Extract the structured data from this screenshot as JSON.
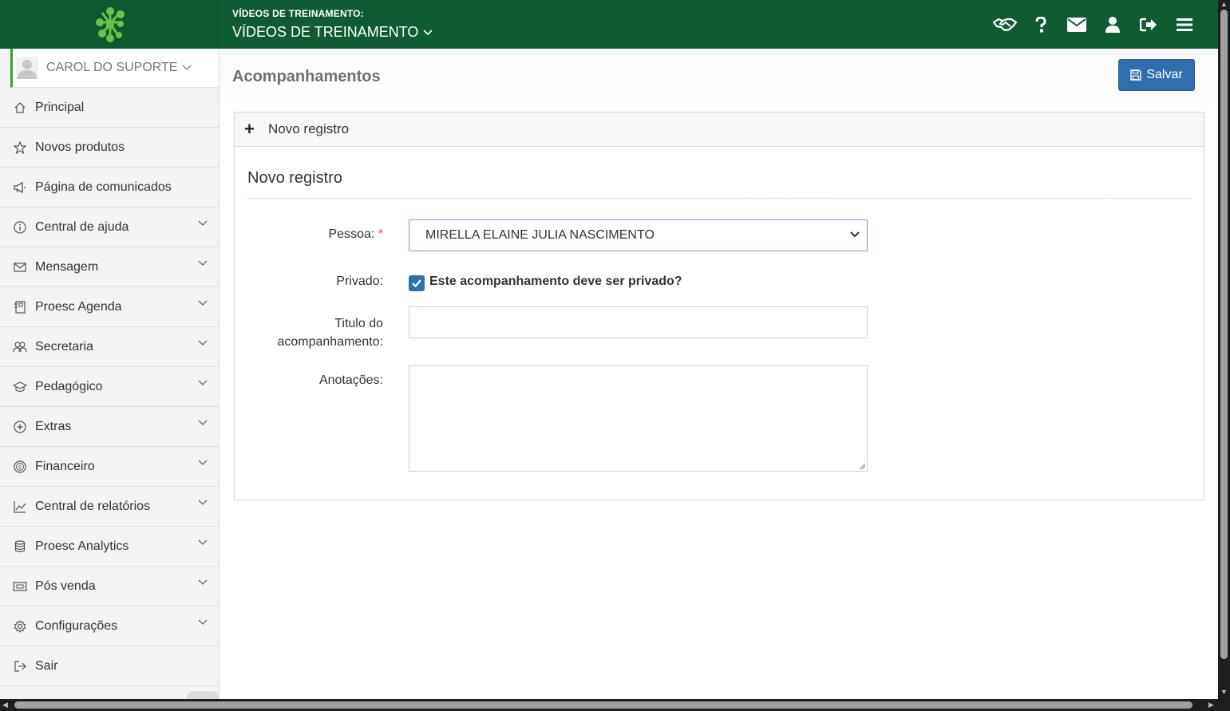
{
  "header": {
    "section_label": "VÍDEOS DE TREINAMENTO:",
    "section_value": "VÍDEOS DE TREINAMENTO",
    "icons": [
      "handshake-icon",
      "help-icon",
      "mail-icon",
      "user-icon",
      "logout-icon",
      "menu-icon"
    ]
  },
  "sidebar": {
    "user": "CAROL DO SUPORTE",
    "items": [
      {
        "label": "Principal",
        "icon": "home-icon",
        "expandable": false
      },
      {
        "label": "Novos produtos",
        "icon": "star-icon",
        "expandable": false
      },
      {
        "label": "Página de comunicados",
        "icon": "megaphone-icon",
        "expandable": false
      },
      {
        "label": "Central de ajuda",
        "icon": "info-icon",
        "expandable": true
      },
      {
        "label": "Mensagem",
        "icon": "envelope-icon",
        "expandable": true
      },
      {
        "label": "Proesc Agenda",
        "icon": "agenda-icon",
        "expandable": true
      },
      {
        "label": "Secretaria",
        "icon": "people-icon",
        "expandable": true
      },
      {
        "label": "Pedagógico",
        "icon": "graduation-cap-icon",
        "expandable": true
      },
      {
        "label": "Extras",
        "icon": "plus-circle-icon",
        "expandable": true
      },
      {
        "label": "Financeiro",
        "icon": "dollar-circle-icon",
        "expandable": true
      },
      {
        "label": "Central de relatórios",
        "icon": "line-chart-icon",
        "expandable": true
      },
      {
        "label": "Proesc Analytics",
        "icon": "database-icon",
        "expandable": true
      },
      {
        "label": "Pós venda",
        "icon": "ticket-icon",
        "expandable": true
      },
      {
        "label": "Configurações",
        "icon": "gear-icon",
        "expandable": true
      },
      {
        "label": "Sair",
        "icon": "exit-icon",
        "expandable": false
      }
    ]
  },
  "main": {
    "title": "Acompanhamentos",
    "save_label": "Salvar",
    "panel_title": "Novo registro",
    "section_title": "Novo registro",
    "form": {
      "pessoa_label": "Pessoa:",
      "pessoa_required": "*",
      "pessoa_value": "MIRELLA ELAINE JULIA NASCIMENTO",
      "privado_label": "Privado:",
      "privado_checked": true,
      "privado_text": "Este acompanhamento deve ser privado?",
      "titulo_label_1": "Titulo do",
      "titulo_label_2": "acompanhamento:",
      "titulo_value": "",
      "anotacoes_label": "Anotações:",
      "anotacoes_value": ""
    }
  },
  "colors": {
    "header_bg": "#0f5c34",
    "primary_button": "#2f6fae",
    "required": "#d9534f"
  }
}
